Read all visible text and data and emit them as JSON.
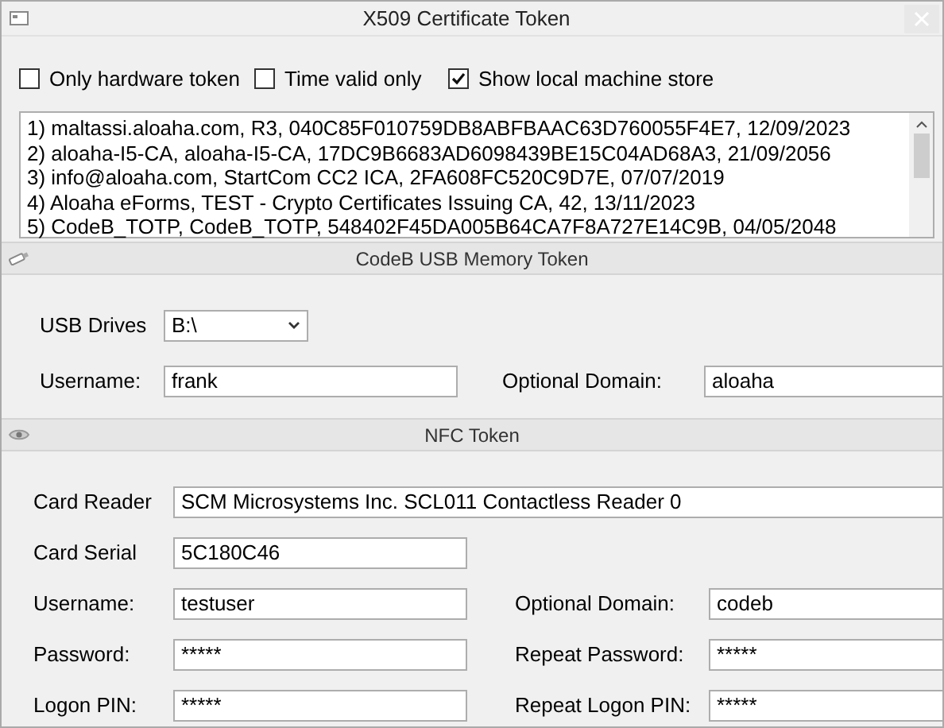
{
  "window": {
    "title": "X509 Certificate Token"
  },
  "filters": [
    {
      "label": "Only hardware token",
      "checked": false
    },
    {
      "label": "Time valid only",
      "checked": false
    },
    {
      "label": "Show local machine store",
      "checked": true
    }
  ],
  "certificates": [
    "1) maltassi.aloaha.com, R3, 040C85F010759DB8ABFBAAC63D760055F4E7, 12/09/2023",
    "2) aloaha-I5-CA, aloaha-I5-CA, 17DC9B6683AD6098439BE15C04AD68A3, 21/09/2056",
    "3) info@aloaha.com, StartCom CC2 ICA, 2FA608FC520C9D7E, 07/07/2019",
    "4) Aloaha eForms, TEST - Crypto Certificates Issuing CA, 42, 13/11/2023",
    "5) CodeB_TOTP, CodeB_TOTP, 548402F45DA005B64CA7F8A727E14C9B, 04/05/2048"
  ],
  "sections": [
    {
      "kind": "usb",
      "title": "CodeB USB Memory Token",
      "rows": [
        [
          {
            "label": "USB Drives",
            "value": "B:\\",
            "kind": "dropdown"
          }
        ],
        [
          {
            "label": "Username:",
            "value": "frank",
            "kind": "text"
          },
          {
            "label": "Optional Domain:",
            "value": "aloaha",
            "kind": "text"
          }
        ]
      ]
    },
    {
      "kind": "nfc",
      "title": "NFC Token",
      "rows": [
        [
          {
            "label": "Card Reader",
            "value": "SCM Microsystems Inc. SCL011 Contactless Reader 0",
            "kind": "wide"
          }
        ],
        [
          {
            "label": "Card Serial",
            "value": "5C180C46",
            "kind": "text"
          }
        ],
        [
          {
            "label": "Username:",
            "value": "testuser",
            "kind": "text"
          },
          {
            "label": "Optional Domain:",
            "value": "codeb",
            "kind": "text"
          }
        ],
        [
          {
            "label": "Password:",
            "value": "*****",
            "kind": "text"
          },
          {
            "label": "Repeat Password:",
            "value": "*****",
            "kind": "text"
          }
        ],
        [
          {
            "label": "Logon PIN:",
            "value": "*****",
            "kind": "text"
          },
          {
            "label": "Repeat Logon PIN:",
            "value": "*****",
            "kind": "text"
          }
        ]
      ]
    }
  ]
}
